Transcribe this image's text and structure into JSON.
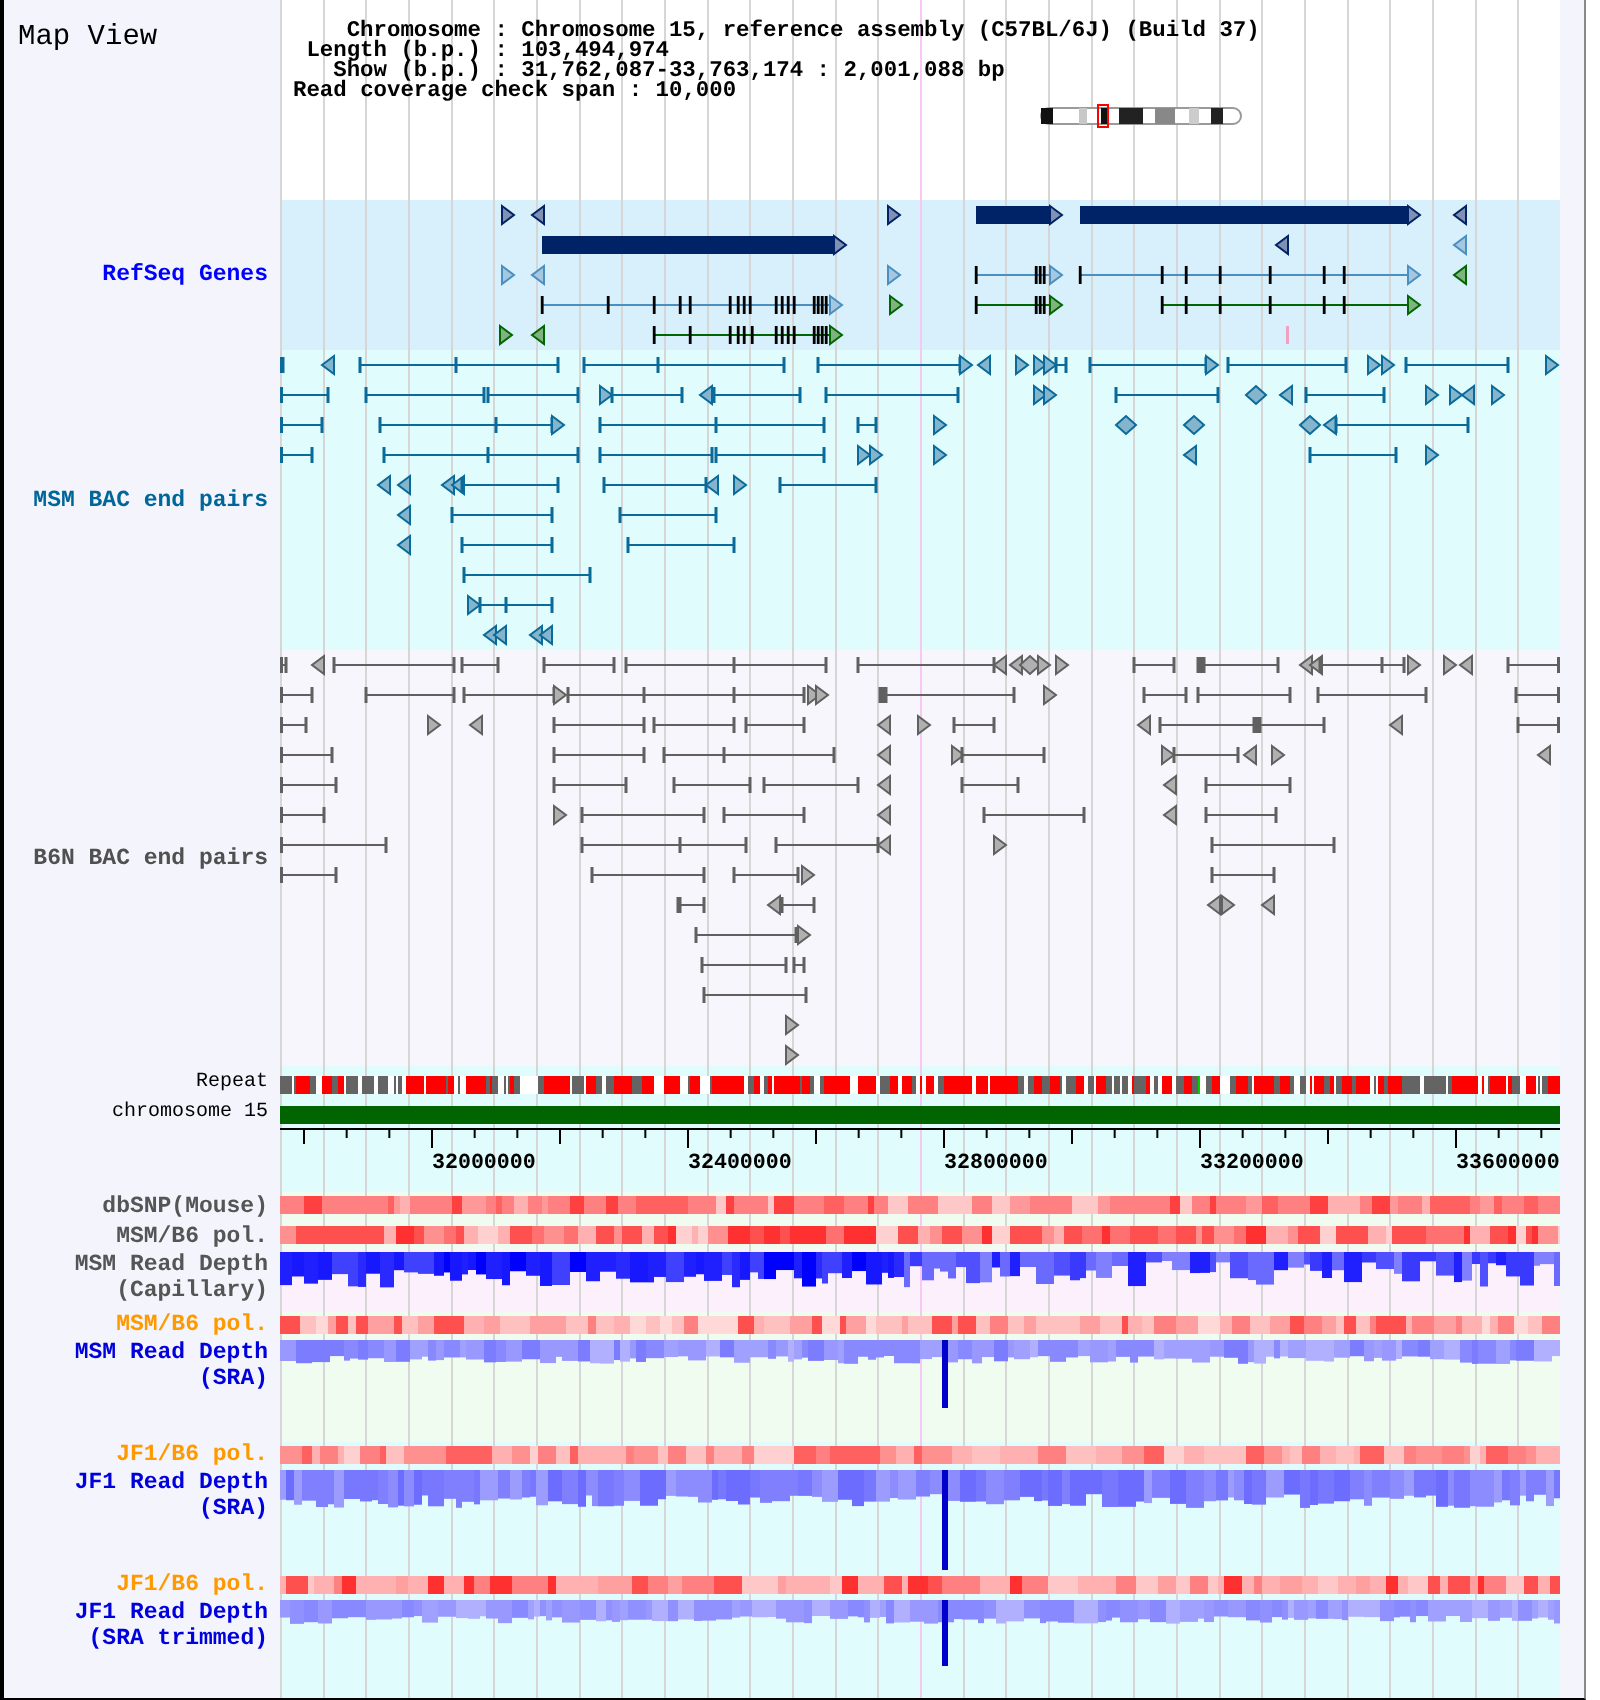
{
  "view": {
    "title": "Map View"
  },
  "info": {
    "separator": ":",
    "rows": [
      {
        "label": "Chromosome",
        "value": "Chromosome 15, reference assembly (C57BL/6J) (Build 37)"
      },
      {
        "label": "Length (b.p.)",
        "value": "103,494,974"
      },
      {
        "label": "Show (b.p.)",
        "value": "31,762,087-33,763,174 : 2,001,088 bp"
      },
      {
        "label": "Read coverage check span",
        "value": "10,000"
      }
    ]
  },
  "tracks": [
    {
      "label": "RefSeq Genes",
      "color": "#0000ff",
      "kind": "genes"
    },
    {
      "label": "MSM BAC end pairs",
      "color": "#006699",
      "kind": "bac_pairs"
    },
    {
      "label": "B6N BAC end pairs",
      "color": "#505050",
      "kind": "bac_pairs"
    },
    {
      "label": "Repeat",
      "color": "#000000",
      "kind": "repeat"
    },
    {
      "label": "chromosome 15",
      "color": "#000000",
      "kind": "chromosome"
    },
    {
      "kind": "ruler",
      "ticks": [
        "32000000",
        "32400000",
        "32800000",
        "33200000",
        "33600000"
      ]
    },
    {
      "label": "dbSNP(Mouse)",
      "color": "#555555",
      "kind": "heat"
    },
    {
      "label": "MSM/B6 pol.",
      "color": "#555555",
      "kind": "heat"
    },
    {
      "label": "MSM Read Depth (Capillary)",
      "color": "#555555",
      "kind": "depth"
    },
    {
      "label": "MSM/B6 pol.",
      "color": "#ff9900",
      "kind": "heat"
    },
    {
      "label": "MSM Read Depth (SRA)",
      "color": "#0000dd",
      "kind": "depth"
    },
    {
      "label": "JF1/B6 pol.",
      "color": "#ff9900",
      "kind": "heat"
    },
    {
      "label": "JF1 Read Depth (SRA)",
      "color": "#0000dd",
      "kind": "depth"
    },
    {
      "label": "JF1/B6 pol.",
      "color": "#ff9900",
      "kind": "heat"
    },
    {
      "label": "JF1 Read Depth (SRA trimmed)",
      "color": "#0000dd",
      "kind": "depth"
    }
  ]
}
